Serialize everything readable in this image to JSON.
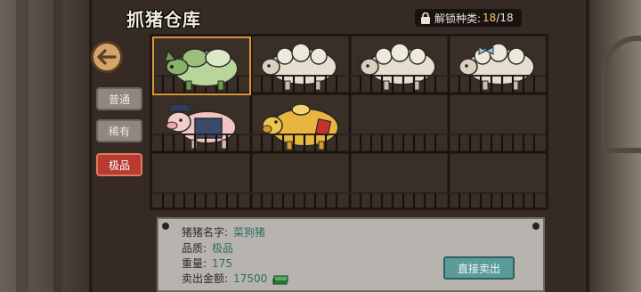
{
  "header": {
    "title": "抓猪仓库",
    "unlock_label": "解锁种类:",
    "unlock_count": "18",
    "unlock_total": "/18"
  },
  "tabs": [
    {
      "label": "普通",
      "active": false
    },
    {
      "label": "稀有",
      "active": false
    },
    {
      "label": "极品",
      "active": true
    }
  ],
  "cages": [
    {
      "pig": "cabbage-dog-pig",
      "selected": true
    },
    {
      "pig": "sheep-pig",
      "selected": false
    },
    {
      "pig": "sheep-pig",
      "selected": false
    },
    {
      "pig": "sheep-pig-with-bow",
      "selected": false
    },
    {
      "pig": "police-pig",
      "selected": false
    },
    {
      "pig": "gold-lucky-pig",
      "selected": false
    },
    {
      "pig": "",
      "selected": false
    },
    {
      "pig": "",
      "selected": false
    },
    {
      "pig": "",
      "selected": false
    },
    {
      "pig": "",
      "selected": false
    },
    {
      "pig": "",
      "selected": false
    },
    {
      "pig": "",
      "selected": false
    }
  ],
  "info": {
    "name_label": "猪猪名字:",
    "name_value": "菜狗猪",
    "quality_label": "品质:",
    "quality_value": "极品",
    "weight_label": "重量:",
    "weight_value": "175",
    "price_label": "卖出金额:",
    "price_value": "17500",
    "sell_button": "直接卖出"
  },
  "colors": {
    "accent_orange": "#f6c36a",
    "active_tab": "#b83a30",
    "sell_button": "#5b9c9a",
    "value_text": "#2f6b63"
  }
}
